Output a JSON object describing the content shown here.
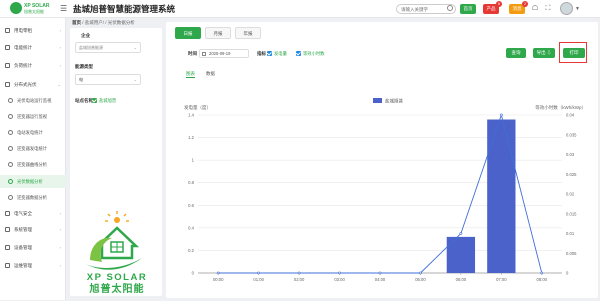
{
  "header": {
    "logo_text": "XP SOLAR",
    "logo_sub": "旭普太阳能",
    "app_title": "盐城旭普智慧能源管理系统",
    "search_placeholder": "请输入关键字",
    "buttons": [
      {
        "label": "首页",
        "badge": "",
        "color": "#2ea84a"
      },
      {
        "label": "产品",
        "badge": "5",
        "color": "#e53935"
      },
      {
        "label": "消息",
        "badge": "2",
        "color": "#f39c12"
      }
    ]
  },
  "sidebar": {
    "items": [
      {
        "label": "用电零租",
        "icon": "bolt-icon"
      },
      {
        "label": "电能统计",
        "icon": "chart-icon"
      },
      {
        "label": "负荷统计",
        "icon": "load-icon"
      },
      {
        "label": "分布式光伏",
        "icon": "solar-icon",
        "expanded": true
      }
    ],
    "subitems": [
      {
        "label": "光伏电站运行监视",
        "active": false
      },
      {
        "label": "逆变器运行监视",
        "active": false
      },
      {
        "label": "电站发电统计",
        "active": false
      },
      {
        "label": "逆变器发电统计",
        "active": false
      },
      {
        "label": "逆变器曲线分析",
        "active": false
      },
      {
        "label": "光伏数据分析",
        "active": true
      },
      {
        "label": "逆变器数据分析",
        "active": false
      }
    ],
    "items_after": [
      {
        "label": "电气安全",
        "icon": "safety-icon"
      },
      {
        "label": "系统管理",
        "icon": "system-icon"
      },
      {
        "label": "设备管理",
        "icon": "device-icon"
      },
      {
        "label": "运维管理",
        "icon": "ops-icon"
      }
    ]
  },
  "breadcrumb": {
    "home": "首页",
    "path": "/ 盐城用户/ / 光伏数据分析"
  },
  "left_panel": {
    "enterprise_label": "企业",
    "enterprise_value": "盐城旭普能源",
    "energy_type_label": "能源类型",
    "energy_type_value": "电",
    "station_label": "站点名称",
    "station_value": "盐城旭普"
  },
  "tabs": [
    "日报",
    "月报",
    "年报"
  ],
  "active_tab": 0,
  "filters": {
    "time_label": "时间",
    "date_value": "2025-09-19",
    "metric_label": "指标",
    "metric_1": "发电量",
    "metric_2": "等效小时数"
  },
  "actions": {
    "query": "查询",
    "export": "导出",
    "print": "打印"
  },
  "subtabs": [
    "图表",
    "数据"
  ],
  "chart_data": {
    "type": "bar",
    "legend": "盐城旭普",
    "ylabel_left": "发电量（度）",
    "ylabel_right": "等效小时数（kWh/kWp）",
    "categories": [
      "00:00",
      "01:00",
      "02:00",
      "03:00",
      "04:00",
      "05:00",
      "06:00",
      "07:00",
      "08:00"
    ],
    "series": [
      {
        "name": "盐城旭普",
        "kind": "bar",
        "axis": "left",
        "color": "#4a62c9",
        "values": [
          0,
          0,
          0,
          0,
          0,
          0,
          0.32,
          1.36,
          0
        ]
      },
      {
        "name": "",
        "kind": "line",
        "axis": "right",
        "color": "#3f6fd8",
        "values": [
          0,
          0,
          0,
          0,
          0,
          0,
          0.01,
          0.04,
          0
        ]
      }
    ],
    "yleft": {
      "min": 0,
      "max": 1.4,
      "ticks": [
        0,
        0.2,
        0.4,
        0.6,
        0.8,
        1,
        1.2,
        1.4
      ]
    },
    "yright": {
      "min": 0,
      "max": 0.04,
      "ticks": [
        0,
        0.005,
        0.01,
        0.015,
        0.02,
        0.025,
        0.03,
        0.035,
        0.04
      ]
    },
    "grid": true,
    "legend_position": "top-center"
  }
}
